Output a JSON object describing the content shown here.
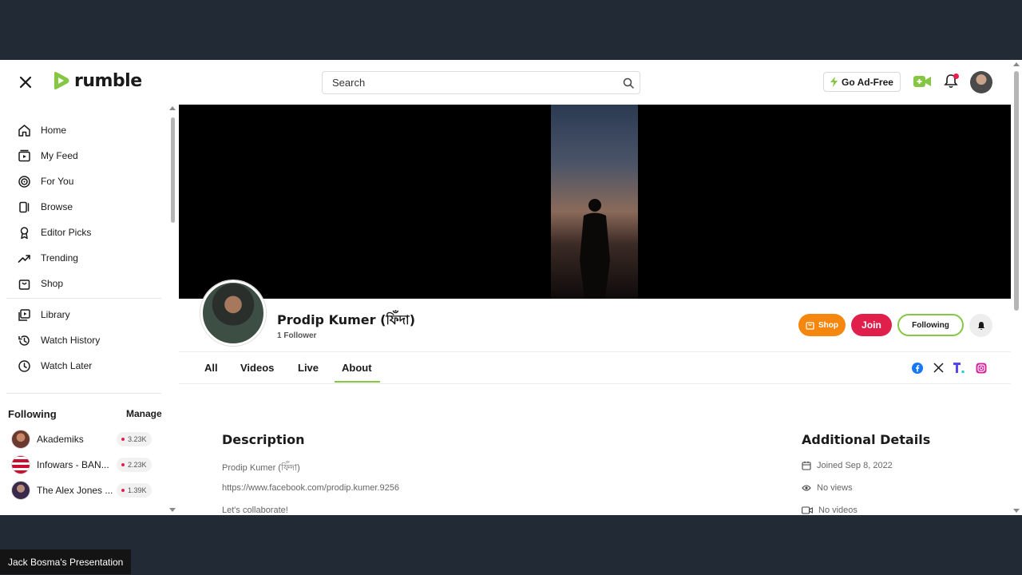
{
  "header": {
    "logo_text": "rumble",
    "search_placeholder": "Search",
    "go_adfree_label": "Go Ad-Free"
  },
  "sidebar": {
    "items": [
      {
        "label": "Home",
        "icon": "home-icon"
      },
      {
        "label": "My Feed",
        "icon": "feed-icon"
      },
      {
        "label": "For You",
        "icon": "target-icon"
      },
      {
        "label": "Browse",
        "icon": "browse-icon"
      },
      {
        "label": "Editor Picks",
        "icon": "award-icon"
      },
      {
        "label": "Trending",
        "icon": "trending-icon"
      },
      {
        "label": "Shop",
        "icon": "shop-bag-icon"
      }
    ],
    "library_items": [
      {
        "label": "Library",
        "icon": "library-icon"
      },
      {
        "label": "Watch History",
        "icon": "history-icon"
      },
      {
        "label": "Watch Later",
        "icon": "clock-icon"
      }
    ],
    "following_title": "Following",
    "manage_label": "Manage",
    "following": [
      {
        "name": "Akademiks",
        "count": "3.23K"
      },
      {
        "name": "Infowars - BAN...",
        "count": "2.23K"
      },
      {
        "name": "The Alex Jones ...",
        "count": "1.39K"
      }
    ]
  },
  "channel": {
    "name": "Prodip Kumer (ফিঁদা)",
    "followers": "1 Follower",
    "shop_label": "Shop",
    "join_label": "Join",
    "following_label": "Following"
  },
  "tabs": [
    {
      "label": "All"
    },
    {
      "label": "Videos"
    },
    {
      "label": "Live"
    },
    {
      "label": "About",
      "active": true
    }
  ],
  "about": {
    "description_title": "Description",
    "description_lines": [
      "Prodip Kumer (ফিঁদা)",
      "https://www.facebook.com/prodip.kumer.9256",
      "Let's collaborate!"
    ],
    "details_title": "Additional Details",
    "joined": "Joined Sep 8, 2022",
    "views": "No views",
    "videos": "No videos"
  },
  "presenter_label": "Jack Bosma's Presentation",
  "colors": {
    "brand_green": "#85c742",
    "join_red": "#e11f4b",
    "shop_orange": "#f5870f",
    "page_bg": "#222a35"
  }
}
